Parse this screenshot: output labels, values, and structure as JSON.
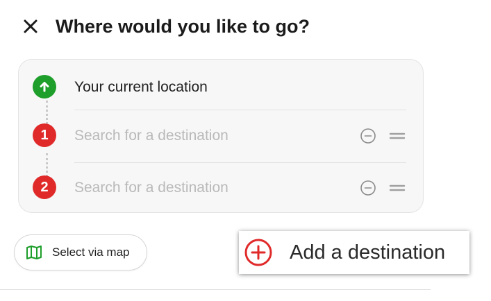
{
  "header": {
    "title": "Where would you like to go?",
    "close_icon": "close-icon"
  },
  "route": {
    "origin": {
      "label": "Your current location",
      "marker_icon": "arrow-up-icon",
      "marker_color": "#1e9e2a"
    },
    "destinations": [
      {
        "number": "1",
        "value": "",
        "placeholder": "Search for a destination",
        "marker_color": "#e02a2a",
        "remove_icon": "minus-circle-icon",
        "drag_icon": "drag-handle-icon"
      },
      {
        "number": "2",
        "value": "",
        "placeholder": "Search for a destination",
        "marker_color": "#e02a2a",
        "remove_icon": "minus-circle-icon",
        "drag_icon": "drag-handle-icon"
      }
    ]
  },
  "actions": {
    "select_via_map": {
      "label": "Select via map",
      "icon": "map-icon",
      "icon_color": "#1e9e2a"
    },
    "add_destination": {
      "label": "Add a destination",
      "icon": "plus-circle-icon",
      "icon_color": "#e02a2a"
    }
  }
}
